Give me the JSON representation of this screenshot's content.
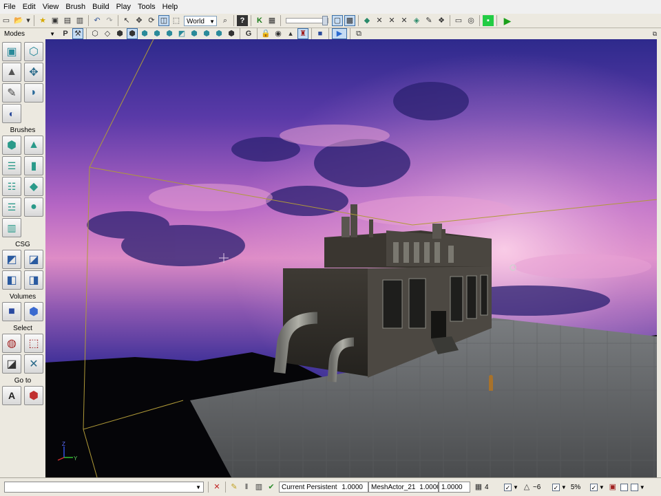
{
  "menu": [
    "File",
    "Edit",
    "View",
    "Brush",
    "Build",
    "Play",
    "Tools",
    "Help"
  ],
  "toolbar": {
    "coord_system": "World"
  },
  "sidebar": {
    "modes_label": "Modes",
    "brushes_label": "Brushes",
    "csg_label": "CSG",
    "volumes_label": "Volumes",
    "select_label": "Select",
    "goto_label": "Go to"
  },
  "viewport": {
    "axis_z": "Z",
    "axis_y": "Y"
  },
  "status": {
    "current_level": "Current Persistent",
    "value1": "1.0000",
    "actor": "MeshActor_21",
    "value2": "1.0000",
    "value3": "1.0000",
    "grid_size": "4",
    "rot_snap": "~6",
    "scale_snap": "5%"
  },
  "colors": {
    "sky_top": "#3b2a8a",
    "sky_pink": "#d882c0",
    "floor": "#6a6c6e",
    "accent": "#3a6ea5"
  }
}
